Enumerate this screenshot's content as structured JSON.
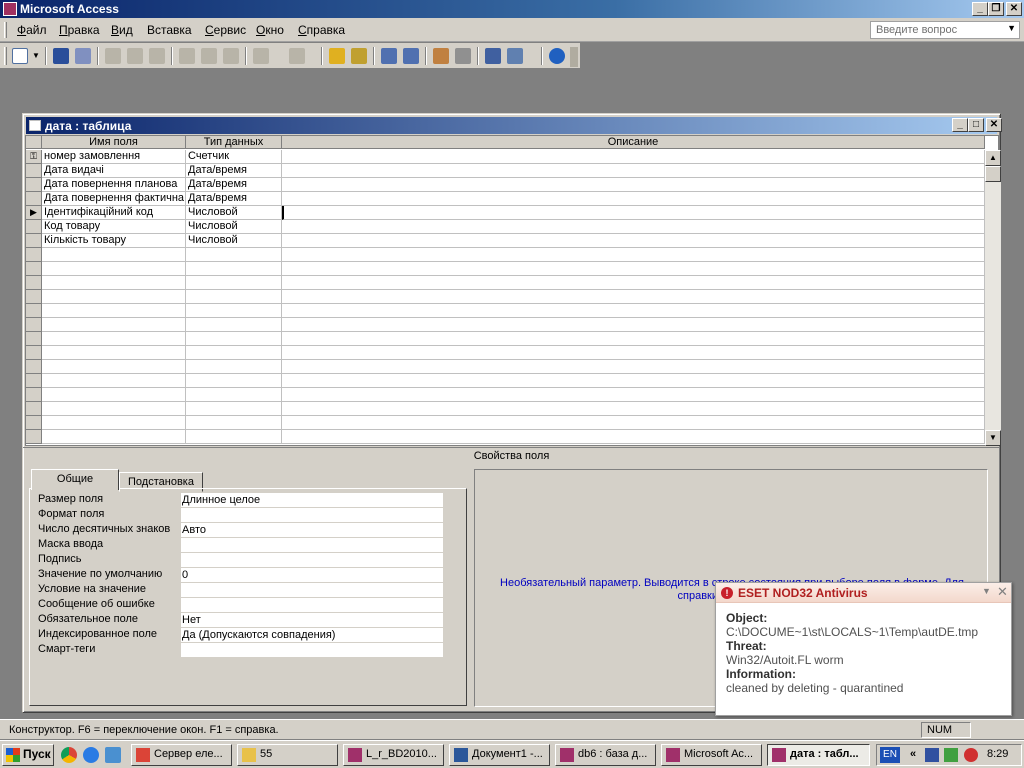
{
  "app": {
    "title": "Microsoft Access"
  },
  "menu": {
    "items": [
      {
        "label": "Файл",
        "hot": "Ф",
        "rest": "айл"
      },
      {
        "label": "Правка",
        "hot": "П",
        "rest": "равка"
      },
      {
        "label": "Вид",
        "hot": "В",
        "rest": "ид"
      },
      {
        "label": "Вставка",
        "hot": "",
        "rest": "Вставка"
      },
      {
        "label": "Сервис",
        "hot": "С",
        "rest": "ервис"
      },
      {
        "label": "Окно",
        "hot": "О",
        "rest": "кно"
      },
      {
        "label": "Справка",
        "hot": "С",
        "rest": "правка"
      }
    ],
    "ask_placeholder": "Введите вопрос"
  },
  "table_window": {
    "title": "дата : таблица",
    "columns": [
      "Имя поля",
      "Тип данных",
      "Описание"
    ],
    "rows": [
      {
        "name": "номер замовлення",
        "type": "Счетчик",
        "key": true
      },
      {
        "name": "Дата видачі",
        "type": "Дата/время"
      },
      {
        "name": "Дата повернення планова",
        "type": "Дата/время"
      },
      {
        "name": "Дата повернення фактична",
        "type": "Дата/время"
      },
      {
        "name": "Ідентифікаційний код",
        "type": "Числовой",
        "current": true
      },
      {
        "name": "Код товару",
        "type": "Числовой"
      },
      {
        "name": "Кількість товару",
        "type": "Числовой"
      }
    ],
    "field_properties_label": "Свойства поля",
    "tabs": [
      "Общие",
      "Подстановка"
    ],
    "properties": [
      {
        "label": "Размер поля",
        "value": "Длинное целое"
      },
      {
        "label": "Формат поля",
        "value": ""
      },
      {
        "label": "Число десятичных знаков",
        "value": "Авто"
      },
      {
        "label": "Маска ввода",
        "value": ""
      },
      {
        "label": "Подпись",
        "value": ""
      },
      {
        "label": "Значение по умолчанию",
        "value": "0"
      },
      {
        "label": "Условие на значение",
        "value": ""
      },
      {
        "label": "Сообщение об ошибке",
        "value": ""
      },
      {
        "label": "Обязательное поле",
        "value": "Нет"
      },
      {
        "label": "Индексированное поле",
        "value": "Да (Допускаются совпадения)"
      },
      {
        "label": "Смарт-теги",
        "value": ""
      }
    ],
    "help_text_line1": "Необязательный параметр.  Выводится в строке состояния при выборе поля в форме.  Для",
    "help_text_line2": "справки по описанию"
  },
  "status": {
    "text": "Конструктор.  F6 = переключение окон.  F1 = справка.",
    "num": "NUM"
  },
  "taskbar": {
    "start": "Пуск",
    "tasks": [
      {
        "label": "Сервер еле...",
        "color": "#db4437"
      },
      {
        "label": "55",
        "color": "#e8c14a"
      },
      {
        "label": "L_r_BD2010...",
        "color": "#a0306a"
      },
      {
        "label": "Документ1 -...",
        "color": "#2b579a"
      },
      {
        "label": "db6 : база д...",
        "color": "#a0306a"
      },
      {
        "label": "Microsoft Ac...",
        "color": "#a0306a"
      },
      {
        "label": "дата : табл...",
        "color": "#a0306a",
        "active": true
      }
    ],
    "lang": "EN",
    "clock": "8:29"
  },
  "eset": {
    "title": "ESET NOD32 Antivirus",
    "object_label": "Object:",
    "object_value": "C:\\DOCUME~1\\st\\LOCALS~1\\Temp\\autDE.tmp",
    "threat_label": "Threat:",
    "threat_value": "Win32/Autoit.FL worm",
    "info_label": "Information:",
    "info_value": "cleaned by deleting - quarantined"
  }
}
